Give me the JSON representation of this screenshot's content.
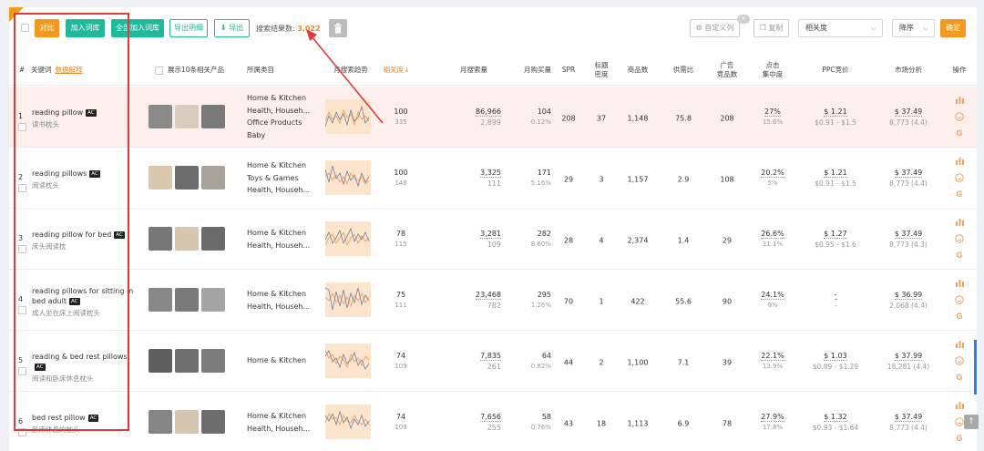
{
  "toolbar": {
    "compare": "对比",
    "add_to_lib": "加入词库",
    "add_all_to_lib": "全部加入词库",
    "export_detail": "导出明细",
    "export": "导出",
    "result_label": "搜索结果数:",
    "result_count": "3,022",
    "custom_columns": "自定义列",
    "custom_badge": "+",
    "collapse": "复制",
    "sort_select": "相关度",
    "order_select": "降序",
    "confirm": "确定"
  },
  "header": {
    "index": "#",
    "keyword": "关键词",
    "data_explain": "数据解释",
    "show_products": "展示10条相关产品",
    "category": "所属类目",
    "trend": "月搜索趋势",
    "relevance": "相关度↓",
    "monthly_search": "月搜索量",
    "monthly_buy": "月购买量",
    "spr": "SPR",
    "title_density_1": "标题",
    "title_density_2": "密度",
    "products": "商品数",
    "supply_ratio": "供需比",
    "ad_1": "广告",
    "ad_2": "竞品数",
    "click_1": "点击",
    "click_2": "集中度",
    "ppc": "PPC竞价",
    "market": "市场分析",
    "ops": "操作"
  },
  "rows": [
    {
      "idx": "1",
      "kw": "reading pillow",
      "ac": "AC",
      "cn": "读书枕头",
      "cats": [
        "Home & Kitchen",
        "Health, Househ...",
        "Office Products",
        "Baby"
      ],
      "rel": "100",
      "rel_sub": "335",
      "search": "86,966",
      "search_sub": "2,899",
      "buy": "104",
      "buy_sub": "0.12%",
      "spr": "208",
      "title": "37",
      "products": "1,148",
      "ratio": "75.8",
      "ad": "208",
      "click": "27%",
      "click_sub": "15.6%",
      "ppc": "$ 1.21",
      "ppc_sub": "$0.91 - $1.5",
      "market": "$ 37.49",
      "market_sub": "8,773 (4.4)"
    },
    {
      "idx": "2",
      "kw": "reading pillows",
      "ac": "AC",
      "cn": "阅读枕头",
      "cats": [
        "Home & Kitchen",
        "Toys & Games",
        "Health, Househ..."
      ],
      "rel": "100",
      "rel_sub": "148",
      "search": "3,325",
      "search_sub": "111",
      "buy": "171",
      "buy_sub": "5.16%",
      "spr": "29",
      "title": "3",
      "products": "1,157",
      "ratio": "2.9",
      "ad": "108",
      "click": "20.2%",
      "click_sub": "5%",
      "ppc": "$ 1.21",
      "ppc_sub": "$0.91 - $1.5",
      "market": "$ 37.49",
      "market_sub": "8,773 (4.4)"
    },
    {
      "idx": "3",
      "kw": "reading pillow for bed",
      "ac": "AC",
      "cn": "床头阅读枕",
      "cats": [
        "Home & Kitchen",
        "Health, Househ..."
      ],
      "rel": "78",
      "rel_sub": "115",
      "search": "3,281",
      "search_sub": "109",
      "buy": "282",
      "buy_sub": "8.60%",
      "spr": "28",
      "title": "4",
      "products": "2,374",
      "ratio": "1.4",
      "ad": "29",
      "click": "26.6%",
      "click_sub": "11.1%",
      "ppc": "$ 1.27",
      "ppc_sub": "$0.95 - $1.6",
      "market": "$ 37.49",
      "market_sub": "8,773 (4.3)"
    },
    {
      "idx": "4",
      "kw": "reading pillows for sitting in bed adult",
      "ac": "AC",
      "cn": "成人坐在床上阅读枕头",
      "cats": [
        "Home & Kitchen",
        "Health, Househ..."
      ],
      "rel": "75",
      "rel_sub": "111",
      "search": "23,468",
      "search_sub": "782",
      "buy": "295",
      "buy_sub": "1.26%",
      "spr": "70",
      "title": "1",
      "products": "422",
      "ratio": "55.6",
      "ad": "90",
      "click": "24.1%",
      "click_sub": "9%",
      "ppc": "-",
      "ppc_sub": "-",
      "market": "$ 36.99",
      "market_sub": "2,068 (4.4)"
    },
    {
      "idx": "5",
      "kw": "reading & bed rest pillows",
      "ac": "AC",
      "cn": "阅读和卧床休息枕头",
      "cats": [
        "Home & Kitchen"
      ],
      "rel": "74",
      "rel_sub": "109",
      "search": "7,835",
      "search_sub": "261",
      "buy": "64",
      "buy_sub": "0.82%",
      "spr": "44",
      "title": "2",
      "products": "1,100",
      "ratio": "7.1",
      "ad": "39",
      "click": "22.1%",
      "click_sub": "13.9%",
      "ppc": "$ 1.03",
      "ppc_sub": "$0.89 - $1.29",
      "market": "$ 37.99",
      "market_sub": "18,281 (4.4)"
    },
    {
      "idx": "6",
      "kw": "bed rest pillow",
      "ac": "AC",
      "cn": "卧床休息的枕头",
      "cats": [
        "Home & Kitchen",
        "Health, Househ..."
      ],
      "rel": "74",
      "rel_sub": "109",
      "search": "7,656",
      "search_sub": "255",
      "buy": "58",
      "buy_sub": "0.76%",
      "spr": "43",
      "title": "18",
      "products": "1,113",
      "ratio": "6.9",
      "ad": "78",
      "click": "27.9%",
      "click_sub": "17.8%",
      "ppc": "$ 1.32",
      "ppc_sub": "$0.93 - $1.64",
      "market": "$ 37.49",
      "market_sub": "8,773 (4.4)"
    }
  ],
  "colors": {
    "orange": "#f39a1e",
    "teal": "#1fb99c",
    "red_box": "#e03a3a",
    "trend_fill": "#fde4cd"
  },
  "icons": [
    "trash-icon",
    "gear-icon",
    "copy-icon",
    "bar-chart-icon",
    "smile-icon",
    "google-icon",
    "arrow-up-icon"
  ]
}
